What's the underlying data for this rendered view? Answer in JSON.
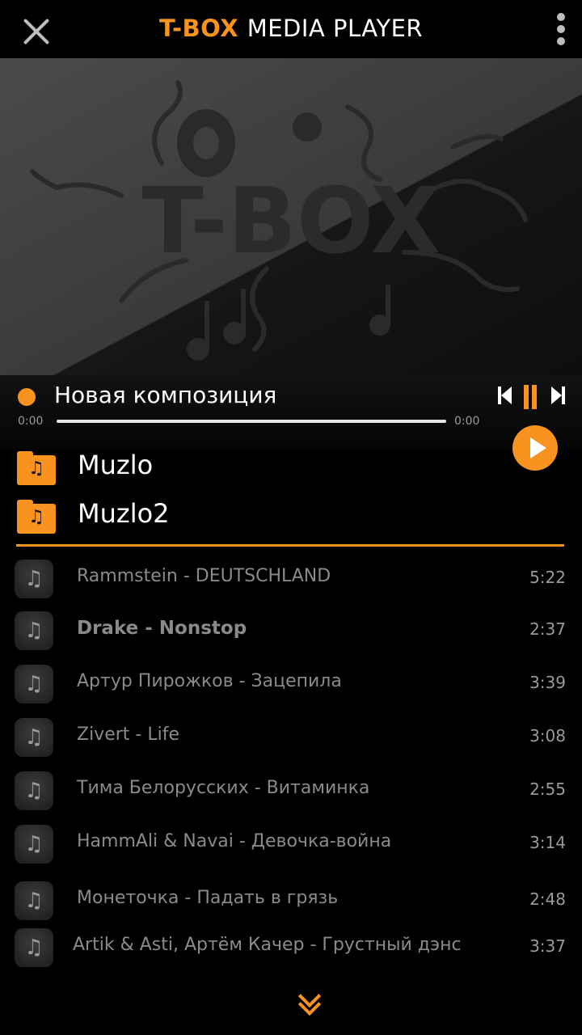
{
  "header": {
    "title_brand": "T-BOX",
    "title_rest": "MEDIA PLAYER",
    "close_icon": "close-icon",
    "menu_icon": "more-vertical-icon"
  },
  "artwork": {
    "logo_text": "T-BOX"
  },
  "now_playing": {
    "title": "Новая композиция",
    "time_elapsed": "0:00",
    "time_total": "0:00",
    "progress": 0
  },
  "folders": [
    {
      "label": "Muzlo"
    },
    {
      "label": "Muzlo2"
    }
  ],
  "tracks": [
    {
      "name": "Rammstein - DEUTSCHLAND",
      "duration": "5:22",
      "active": false
    },
    {
      "name": "Drake - Nonstop",
      "duration": "2:37",
      "active": true
    },
    {
      "name": "Артур Пирожков - Зацепила",
      "duration": "3:39",
      "active": false
    },
    {
      "name": "Zivert - Life",
      "duration": "3:08",
      "active": false
    },
    {
      "name": "Тима Белорусских - Витаминка",
      "duration": "2:55",
      "active": false
    },
    {
      "name": "HammAli & Navai - Девочка-война",
      "duration": "3:14",
      "active": false
    },
    {
      "name": "Монеточка - Падать в грязь",
      "duration": "2:48",
      "active": false
    },
    {
      "name": "Artik & Asti, Артём Качер - Грустный дэнс",
      "duration": "3:37",
      "active": false
    }
  ],
  "colors": {
    "accent": "#f7931e",
    "background": "#000000",
    "track_text": "#8a8a8a"
  }
}
